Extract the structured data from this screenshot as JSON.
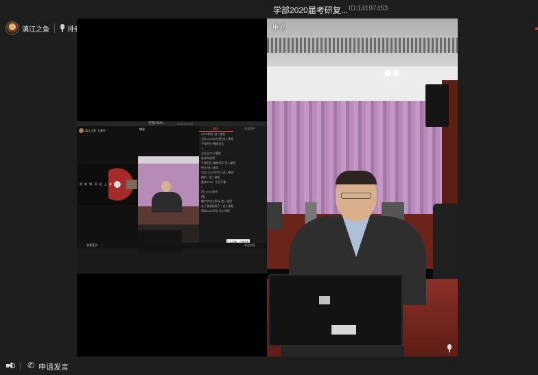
{
  "window": {
    "title": "学部2020届考研复...",
    "room_id": "ID:14197453"
  },
  "host": {
    "name": "漓江之鱼",
    "queue_label": "排麦"
  },
  "video": {
    "speaker_label": "申论"
  },
  "bottom": {
    "request_label": "申请发言"
  },
  "nested_screen": {
    "title": "学部2020...",
    "room_id": "ID:14197453",
    "host_name": "漓江之鱼",
    "queue_label": "上麦中",
    "slide_text": "资 料 知 识 初 上 课",
    "speaker_tag": "申论",
    "tabs": [
      "聊天",
      "在线用户"
    ],
    "chat_messages": [
      "2020考研. 进入课程",
      "当位 2020年位置 进入课程",
      "千里阳光 播放音乐",
      "T",
      "当位全2020套装",
      "谁说你说吧",
      "千里阳光 播放音乐 进入课程",
      "快乐 进入课程",
      "当位 2020年中月 进入课程",
      "端机 . 进入课程",
      "喜欢2020 . 今日开课",
      "T",
      "同上2020老师",
      "[图]",
      "懂中学生之新年 进入课程",
      "关于我想起来了 ! 进入课程",
      "同样2020同学 进入课程"
    ],
    "popup_text": "个人主播 ，已有送礼",
    "bottom_text": "查看更多",
    "bottom_right": "发送消息"
  }
}
